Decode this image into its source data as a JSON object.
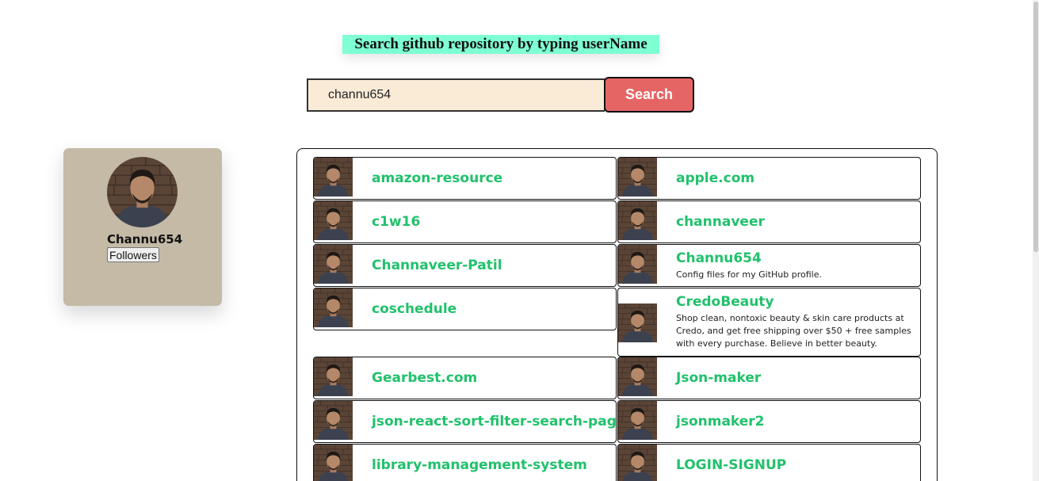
{
  "heading": "Search github repository by typing userName",
  "search": {
    "value": "channu654",
    "button_label": "Search"
  },
  "profile": {
    "name": "Channu654",
    "followers_label": "Followers"
  },
  "repos": [
    {
      "name": "amazon-resource",
      "description": ""
    },
    {
      "name": "apple.com",
      "description": ""
    },
    {
      "name": "c1w16",
      "description": ""
    },
    {
      "name": "channaveer",
      "description": ""
    },
    {
      "name": "Channaveer-Patil",
      "description": ""
    },
    {
      "name": "Channu654",
      "description": "Config files for my GitHub profile."
    },
    {
      "name": "coschedule",
      "description": ""
    },
    {
      "name": "CredoBeauty",
      "description": "Shop clean, nontoxic beauty & skin care products at Credo, and get free shipping over $50 + free samples with every purchase. Believe in better beauty."
    },
    {
      "name": "Gearbest.com",
      "description": ""
    },
    {
      "name": "Json-maker",
      "description": ""
    },
    {
      "name": "json-react-sort-filter-search-pagi",
      "description": ""
    },
    {
      "name": "jsonmaker2",
      "description": ""
    },
    {
      "name": "library-management-system",
      "description": ""
    },
    {
      "name": "LOGIN-SIGNUP",
      "description": ""
    }
  ],
  "colors": {
    "heading_bg": "#7fffd4",
    "input_bg": "#faebd7",
    "button_bg": "#e56565",
    "card_bg": "#c4baa6",
    "repo_name": "#21c16b"
  }
}
